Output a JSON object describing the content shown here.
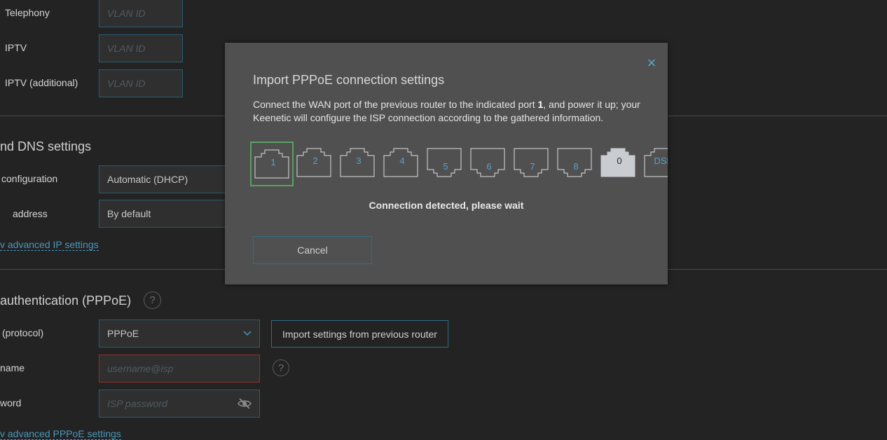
{
  "background": {
    "rows_top": [
      {
        "label": "Telephony",
        "placeholder": "VLAN ID"
      },
      {
        "label": "IPTV",
        "placeholder": "VLAN ID"
      },
      {
        "label": "IPTV (additional)",
        "placeholder": "VLAN ID"
      }
    ],
    "dns_section_title": "nd DNS settings",
    "ip_config_label": "configuration",
    "ip_config_value": "Automatic (DHCP)",
    "address_label": "address",
    "address_value": "By default",
    "advanced_ip_link": "v advanced IP settings",
    "auth_section_title": "authentication (PPPoE)",
    "help_glyph": "?",
    "protocol_label": "(protocol)",
    "protocol_value": "PPPoE",
    "import_button": "Import settings from previous router",
    "username_label": "name",
    "username_placeholder": "username@isp",
    "password_label": "word",
    "password_placeholder": "ISP password",
    "advanced_pppoe_link": "v advanced PPPoE settings"
  },
  "modal": {
    "title": "Import PPPoE connection settings",
    "desc_part1": "Connect the WAN port of the previous router to the indicated port ",
    "desc_port": "1",
    "desc_part2": ", and power it up; your Keenetic will configure the ISP connection according to the gathered information.",
    "ports": [
      "1",
      "2",
      "3",
      "4",
      "5",
      "6",
      "7",
      "8",
      "0",
      "DSL"
    ],
    "active_port": "1",
    "connected_port": "0",
    "status": "Connection detected, please wait",
    "cancel_label": "Cancel",
    "close_glyph": "×"
  },
  "colors": {
    "background": "#232323",
    "modal": "#505050",
    "accent": "#4b97ba",
    "active_port": "#5a9f65",
    "error_border": "#8a3232"
  }
}
